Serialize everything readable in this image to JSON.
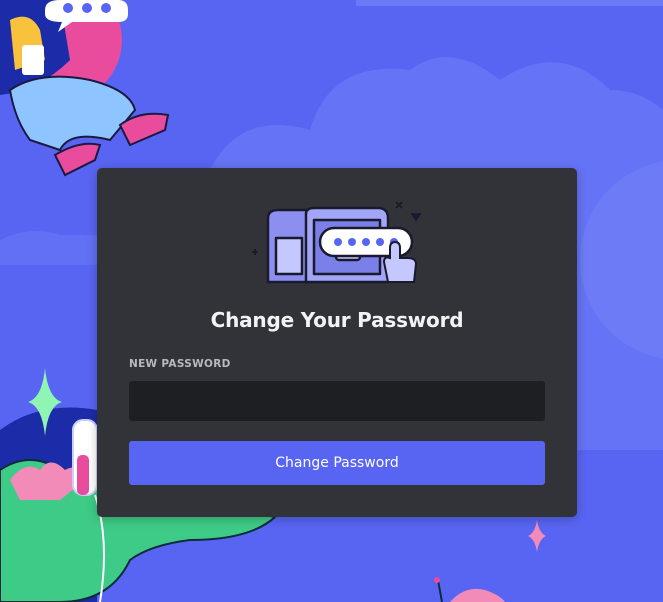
{
  "modal": {
    "title": "Change Your Password",
    "new_password_label": "NEW PASSWORD",
    "new_password_value": "",
    "submit_label": "Change Password"
  },
  "colors": {
    "background": "#5865f2",
    "modal": "#313338",
    "input": "#1e1f22",
    "button": "#5865f2",
    "title": "#f2f3f5",
    "label": "#b5bac1"
  },
  "icons": [
    "treasure-chest-icon",
    "password-bubble-icon",
    "pointing-hand-icon",
    "sparkle-icon",
    "chat-bubble-icon"
  ]
}
